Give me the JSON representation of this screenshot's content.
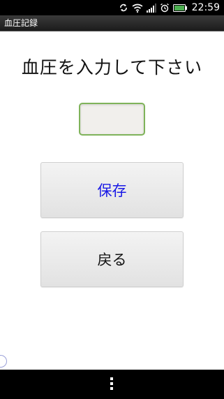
{
  "status_bar": {
    "time": "22:59",
    "icons": [
      "sync-icon",
      "wifi-icon",
      "signal-icon",
      "alarm-icon",
      "battery-icon"
    ],
    "battery_color": "#4caf50"
  },
  "app": {
    "title": "血圧記録"
  },
  "form": {
    "prompt": "血圧を入力して下さい",
    "input_value": "",
    "input_border_color": "#7fb35a"
  },
  "buttons": {
    "save_label": "保存",
    "back_label": "戻る",
    "save_color": "#1a1ae6"
  },
  "nav_bar": {
    "icons": [
      "menu-icon"
    ]
  }
}
